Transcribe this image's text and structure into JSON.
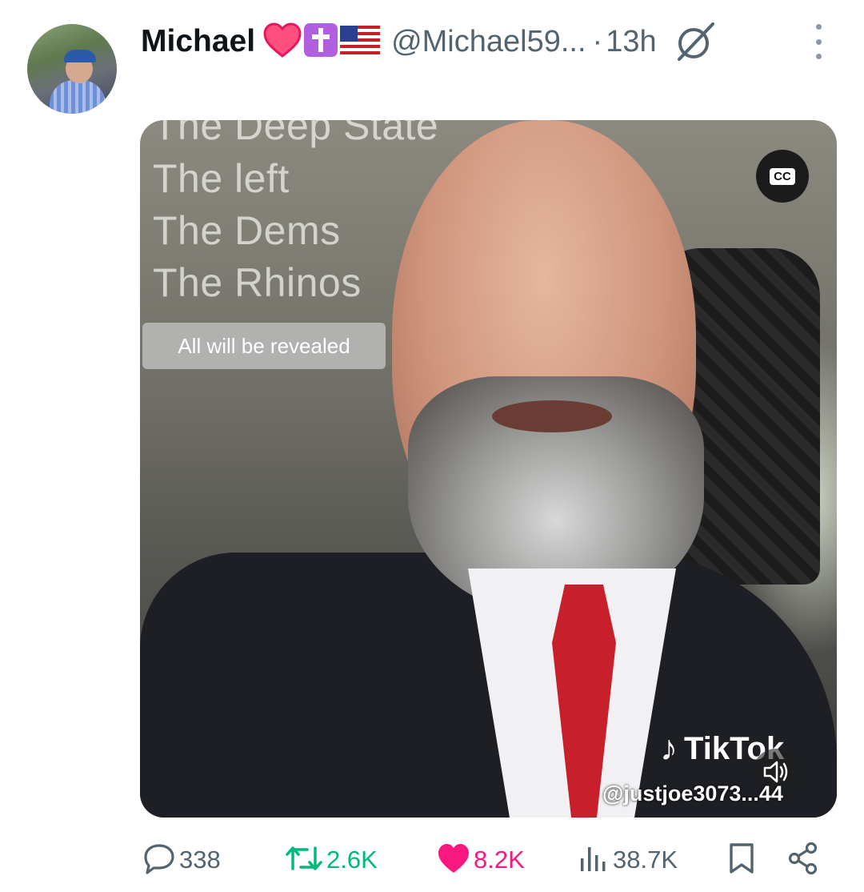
{
  "post": {
    "author_name": "Michael",
    "handle": "@Michael59...",
    "separator": "·",
    "time": "13h"
  },
  "media": {
    "overlay_lines": [
      "The Deep State",
      "The left",
      "The Dems",
      "The Rhinos"
    ],
    "pill_text": "All will be revealed",
    "cc_label": "CC",
    "tiktok_brand": "TikTok",
    "tiktok_user": "@justjoe3073...44"
  },
  "stats": {
    "replies": "338",
    "reposts": "2.6K",
    "likes": "8.2K",
    "views": "38.7K"
  },
  "colors": {
    "muted": "#536471",
    "repost_green": "#00ba7c",
    "like_pink": "#f91880"
  },
  "icons": {
    "badges": [
      "red-heart-icon",
      "latin-cross-icon",
      "us-flag-icon"
    ],
    "header": [
      "grok-icon",
      "more-options-icon"
    ],
    "actions": [
      "reply-icon",
      "repost-icon",
      "like-icon",
      "views-icon",
      "bookmark-icon",
      "share-icon"
    ]
  }
}
